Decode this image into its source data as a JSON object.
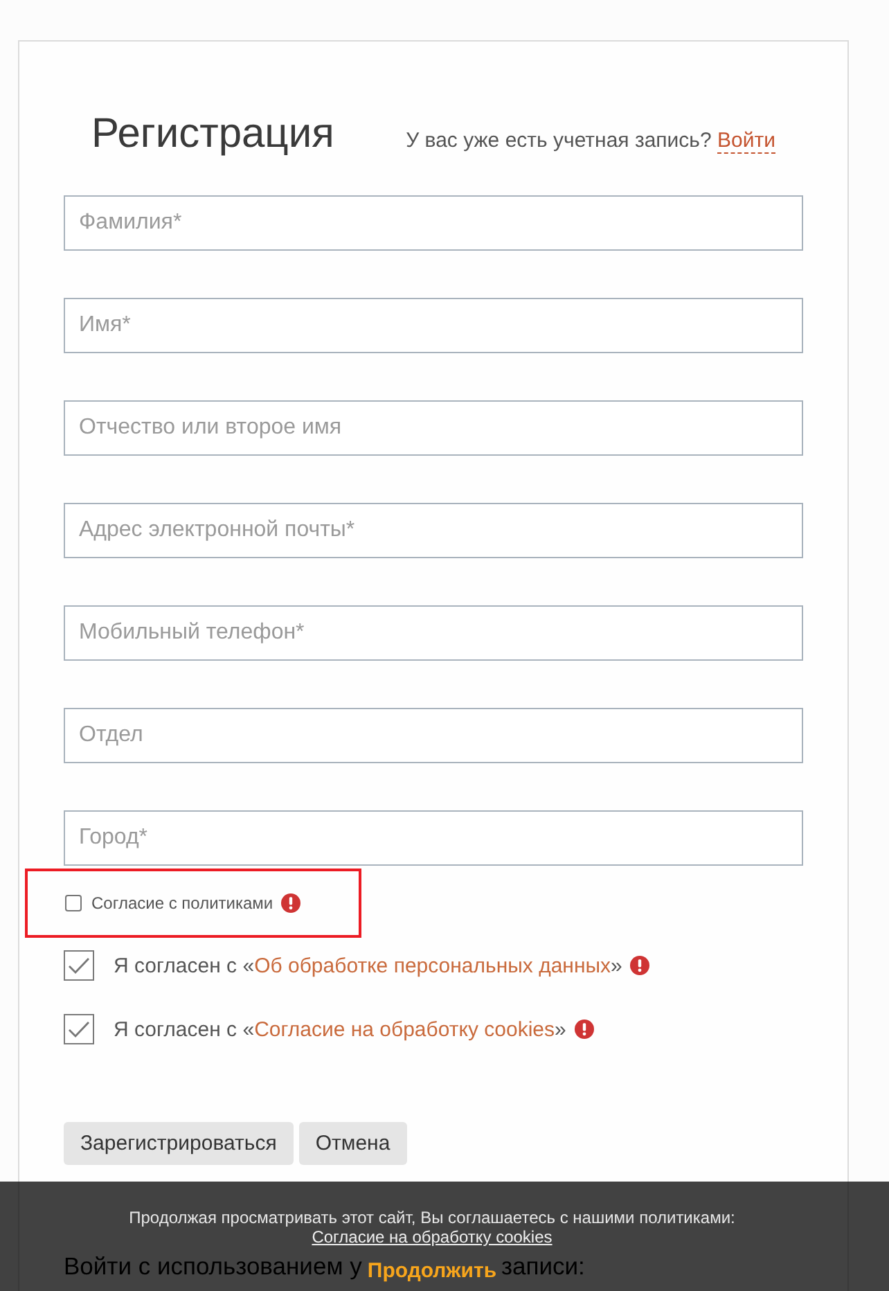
{
  "title": "Регистрация",
  "login_prompt": {
    "text": "У вас уже есть учетная запись?",
    "link": "Войти"
  },
  "fields": [
    {
      "placeholder": "Фамилия*"
    },
    {
      "placeholder": "Имя*"
    },
    {
      "placeholder": "Отчество или второе имя"
    },
    {
      "placeholder": "Адрес электронной почты*"
    },
    {
      "placeholder": "Мобильный телефон*"
    },
    {
      "placeholder": "Отдел"
    },
    {
      "placeholder": "Город*"
    }
  ],
  "policy_consent": {
    "label": "Согласие с политиками",
    "checked": false,
    "highlighted": true,
    "error": true
  },
  "agreements": [
    {
      "text_before": "Я согласен с «",
      "link": "Об обработке персональных данных",
      "text_after": "»",
      "checked": true,
      "error": true
    },
    {
      "text_before": "Я согласен с «",
      "link": "Согласие на обработку cookies",
      "text_after": "»",
      "checked": true,
      "error": true
    }
  ],
  "buttons": [
    "Зарегистрироваться",
    "Отмена"
  ],
  "social_login": {
    "heading_start": "Войти с использованием у",
    "heading_end": "записи:"
  },
  "cookie_banner": {
    "message": "Продолжая просматривать этот сайт, Вы соглашаетесь с нашими политиками:",
    "link": "Согласие на обработку cookies",
    "button": "Продолжить"
  }
}
